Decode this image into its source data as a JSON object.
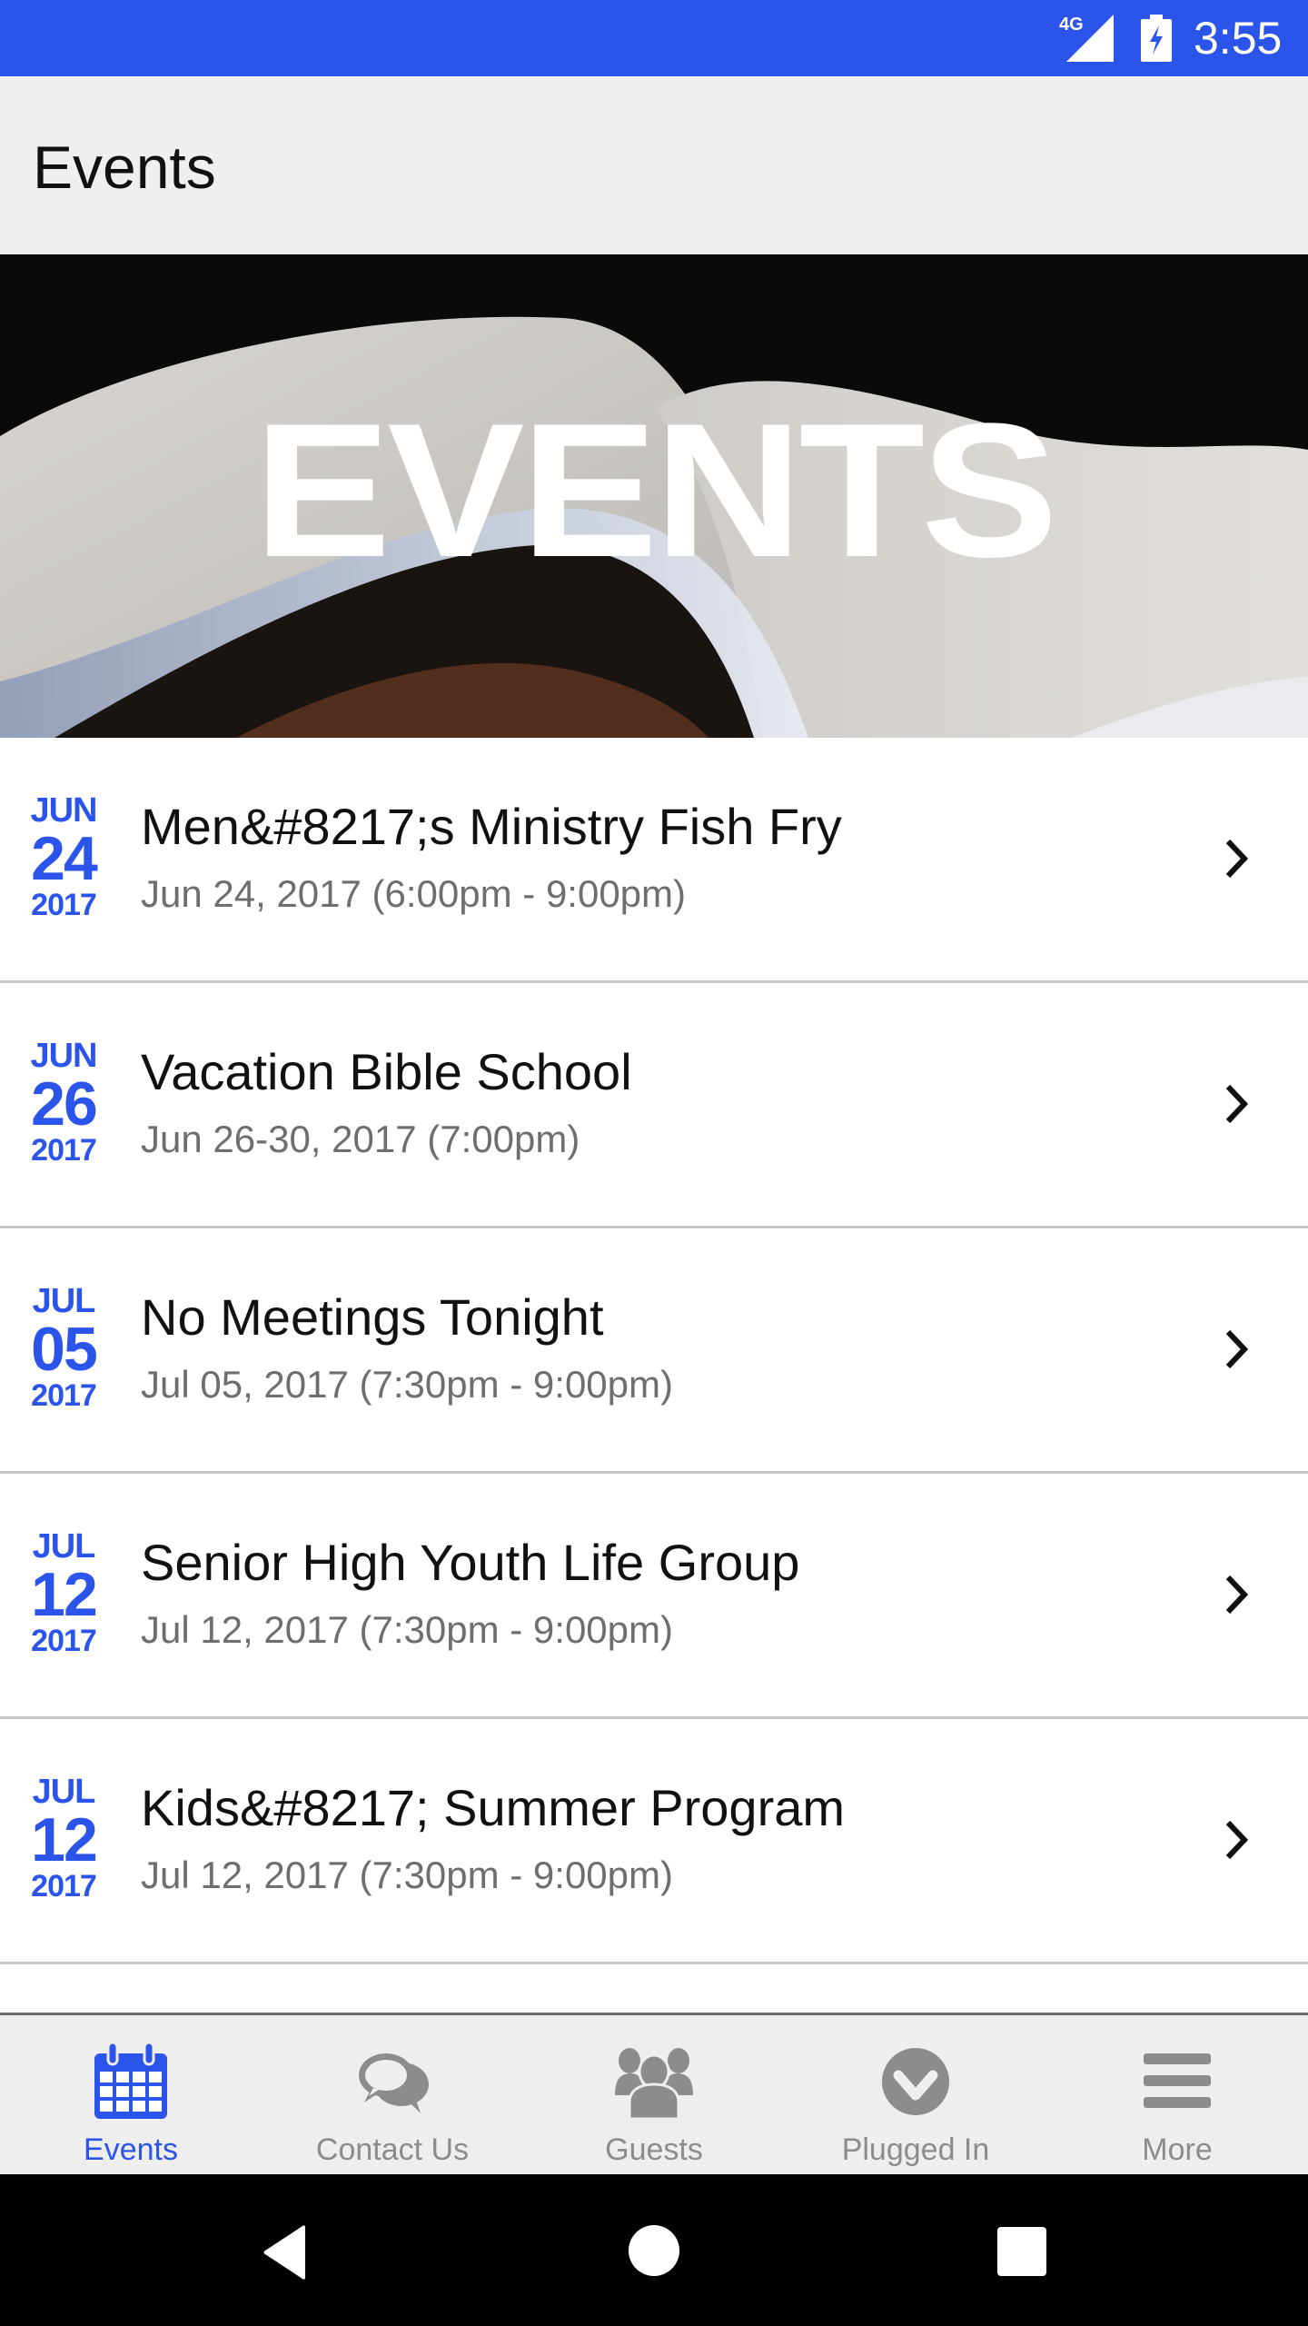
{
  "status_bar": {
    "network": "4G",
    "time": "3:55",
    "icons": [
      "signal-icon",
      "battery-charging-icon"
    ],
    "color": "#2b54ea"
  },
  "app_bar": {
    "title": "Events"
  },
  "banner": {
    "text": "EVENTS",
    "image": "open-book-photo"
  },
  "events": [
    {
      "month": "JUN",
      "day": "24",
      "year": "2017",
      "title": "Men&#8217;s Ministry Fish Fry",
      "subtitle": "Jun 24, 2017 (6:00pm - 9:00pm)"
    },
    {
      "month": "JUN",
      "day": "26",
      "year": "2017",
      "title": "Vacation Bible School",
      "subtitle": "Jun 26-30, 2017 (7:00pm)"
    },
    {
      "month": "JUL",
      "day": "05",
      "year": "2017",
      "title": "No Meetings Tonight",
      "subtitle": "Jul 05, 2017 (7:30pm - 9:00pm)"
    },
    {
      "month": "JUL",
      "day": "12",
      "year": "2017",
      "title": "Senior High Youth Life Group",
      "subtitle": "Jul 12, 2017 (7:30pm - 9:00pm)"
    },
    {
      "month": "JUL",
      "day": "12",
      "year": "2017",
      "title": "Kids&#8217; Summer Program",
      "subtitle": "Jul 12, 2017 (7:30pm - 9:00pm)"
    }
  ],
  "bottom_nav": {
    "active_color": "#2b54ea",
    "inactive_color": "#8c8c8c",
    "items": [
      {
        "label": "Events",
        "icon": "calendar-icon",
        "active": true
      },
      {
        "label": "Contact Us",
        "icon": "chat-bubbles-icon",
        "active": false
      },
      {
        "label": "Guests",
        "icon": "people-group-icon",
        "active": false
      },
      {
        "label": "Plugged In",
        "icon": "chevron-circle-down-icon",
        "active": false
      },
      {
        "label": "More",
        "icon": "hamburger-menu-icon",
        "active": false
      }
    ]
  },
  "system_nav": {
    "buttons": [
      "back",
      "home",
      "recents"
    ]
  }
}
